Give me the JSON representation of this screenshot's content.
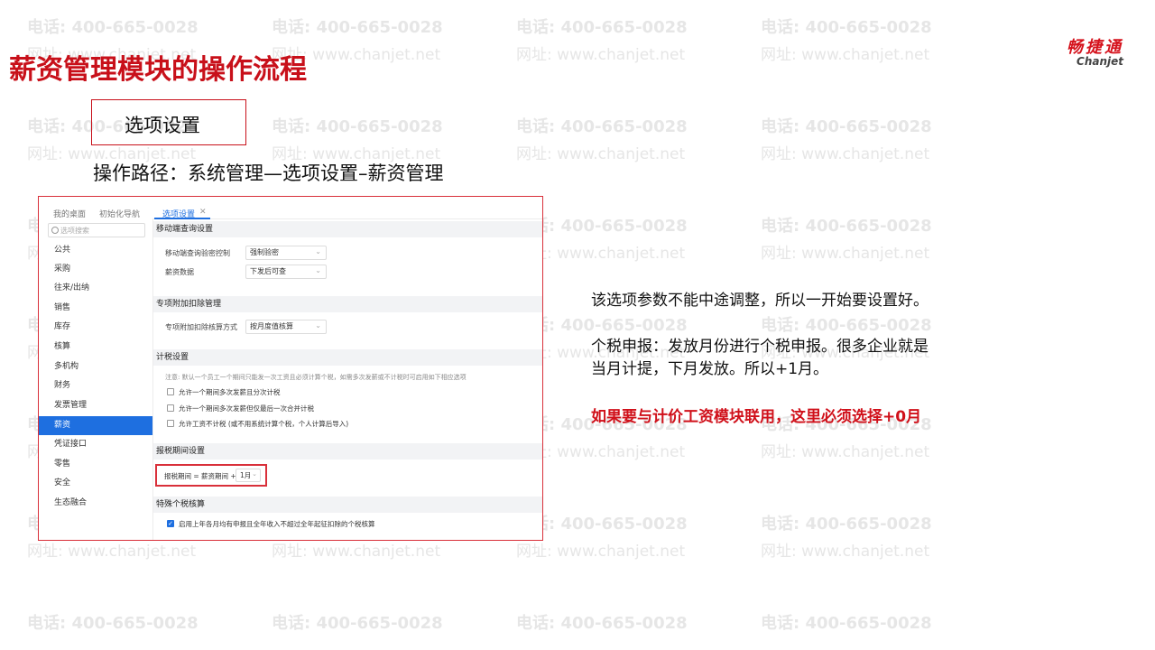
{
  "watermark": {
    "phone": "电话: 400-665-0028",
    "site": "网址: www.chanjet.net"
  },
  "page_title": "薪资管理模块的操作流程",
  "logo": {
    "cn": "畅捷通",
    "en": "Chanjet"
  },
  "section_box_label": "选项设置",
  "operation_path": "操作路径：系统管理—选项设置–薪资管理",
  "screenshot": {
    "tabs": [
      "我的桌面",
      "初始化导航",
      "选项设置"
    ],
    "active_tab_index": 2,
    "search_placeholder": "选项搜索",
    "sidebar_items": [
      "公共",
      "采购",
      "往来/出纳",
      "销售",
      "库存",
      "核算",
      "多机构",
      "财务",
      "发票管理",
      "薪资",
      "凭证接口",
      "零售",
      "安全",
      "生态融合"
    ],
    "sidebar_active_index": 9,
    "group1": {
      "title": "移动端查询设置",
      "row1_label": "移动端查询验密控制",
      "row1_value": "强制验密",
      "row2_label": "薪资数据",
      "row2_value": "下发后可查"
    },
    "group2": {
      "title": "专项附加扣除管理",
      "row_label": "专项附加扣除核算方式",
      "row_value": "按月度值核算"
    },
    "group3": {
      "title": "计税设置",
      "note": "注意: 默认一个员工一个期间只能发一次工资且必须计算个税，如需多次发薪或不计税时可启用如下相应选项",
      "options": [
        {
          "label": "允许一个期间多次发薪且分次计税",
          "checked": false
        },
        {
          "label": "允许一个期间多次发薪但仅最后一次合并计税",
          "checked": false
        },
        {
          "label": "允许工资不计税 (或不用系统计算个税，个人计算后导入)",
          "checked": false
        }
      ]
    },
    "group4": {
      "title": "报税期间设置",
      "formula": "报税期间 = 薪资期间 +",
      "value": "1月"
    },
    "group5": {
      "title": "特殊个税核算",
      "option_label": "启用上年各月均有申报且全年收入不超过全年起征扣除的个税核算",
      "option_checked": true
    }
  },
  "explanations": {
    "line1": "该选项参数不能中途调整，所以一开始要设置好。",
    "line2a": "个税申报：发放月份进行个税申报。很多企业就是",
    "line2b": "当月计提，下月发放。所以+1月。",
    "line3": "如果要与计价工资模块联用，这里必须选择+0月"
  }
}
